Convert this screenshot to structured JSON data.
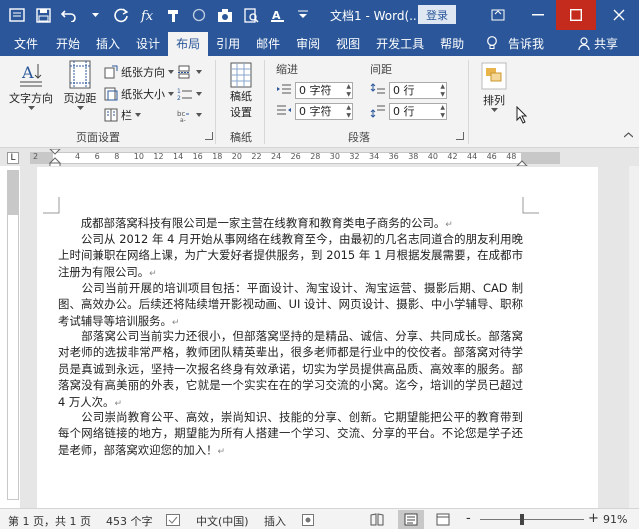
{
  "window": {
    "doc_title": "文档1 - Word(...",
    "login_label": "登录",
    "accent": "#2b579a"
  },
  "tabs": [
    {
      "label": "文件",
      "active": false
    },
    {
      "label": "开始",
      "active": false
    },
    {
      "label": "插入",
      "active": false
    },
    {
      "label": "设计",
      "active": false
    },
    {
      "label": "布局",
      "active": true
    },
    {
      "label": "引用",
      "active": false
    },
    {
      "label": "邮件",
      "active": false
    },
    {
      "label": "审阅",
      "active": false
    },
    {
      "label": "视图",
      "active": false
    },
    {
      "label": "开发工具",
      "active": false
    },
    {
      "label": "帮助",
      "active": false
    }
  ],
  "tab_right": {
    "tell_me": "告诉我",
    "share": "共享"
  },
  "ribbon": {
    "page_setup": {
      "label": "页面设置",
      "text_direction": "文字方向",
      "margins": "页边距",
      "orientation": "纸张方向",
      "size": "纸张大小",
      "columns": "栏"
    },
    "draft": {
      "label": "稿纸",
      "draft_settings_line1": "稿纸",
      "draft_settings_line2": "设置"
    },
    "paragraph": {
      "label": "段落",
      "indent_title": "缩进",
      "spacing_title": "间距",
      "indent_left": "0 字符",
      "indent_right": "0 字符",
      "spacing_before": "0 行",
      "spacing_after": "0 行"
    },
    "arrange": {
      "label": "排列"
    }
  },
  "ruler_numbers": [
    "2",
    "4",
    "6",
    "8",
    "10",
    "12",
    "14",
    "16",
    "18",
    "20",
    "22",
    "24",
    "26",
    "28",
    "30",
    "32",
    "34",
    "36",
    "38",
    "40",
    "42",
    "44",
    "46",
    "48"
  ],
  "document": {
    "paragraphs": [
      "　　成都部落窝科技有限公司是一家主营在线教育和教育类电子商务的公司。",
      "　　公司从 2012 年 4 月开始从事网络在线教育至今，由最初的几名志同道合的朋友利用晚上时间兼职在网络上课，为广大爱好者提供服务，到 2015 年 1 月根据发展需要，在成都市注册为有限公司。",
      "　　公司当前开展的培训项目包括：平面设计、淘宝设计、淘宝运营、摄影后期、CAD 制图、高效办公。后续还将陆续增开影视动画、UI 设计、网页设计、摄影、中小学辅导、职称考试辅导等培训服务。",
      "　　部落窝公司当前实力还很小，但部落窝坚持的是精品、诚信、分享、共同成长。部落窝对老师的选拔非常严格，教师团队精英辈出，很多老师都是行业中的佼佼者。部落窝对待学员是真诚到永远，坚持一次报名终身有效承诺，切实为学员提供高品质、高效率的服务。部落窝没有高美丽的外表，它就是一个实实在在的学习交流的小窝。迄今，培训的学员已超过 4 万人次。",
      "　　公司崇尚教育公平、高效，崇尚知识、技能的分享、创新。它期望能把公平的教育带到每个网络链接的地方，期望能为所有人搭建一个学习、交流、分享的平台。不论您是学子还是老师，部落窝欢迎您的加入！"
    ]
  },
  "status": {
    "page": "第 1 页，共 1 页",
    "words": "453 个字",
    "language": "中文(中国)",
    "mode": "插入",
    "zoom": "91%",
    "zoom_minus": "-",
    "zoom_plus": "+"
  }
}
